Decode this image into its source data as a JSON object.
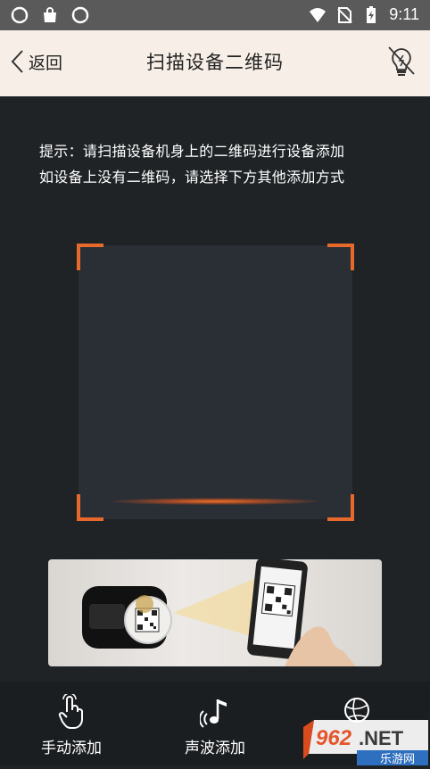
{
  "status_bar": {
    "time": "9:11",
    "icons_left": [
      "sync-icon",
      "shopping-bag-icon",
      "sync-icon"
    ],
    "icons_right": [
      "wifi-icon",
      "no-sim-icon",
      "battery-charging-icon"
    ]
  },
  "header": {
    "back_label": "返回",
    "title": "扫描设备二维码",
    "light_icon": "flashlight-off-icon"
  },
  "hint": {
    "line1": "提示：请扫描设备机身上的二维码进行设备添加",
    "line2": "如设备上没有二维码，请选择下方其他添加方式"
  },
  "colors": {
    "accent": "#e7692c",
    "background": "#1f2326",
    "header_bg": "#f7efe7",
    "bottom_bar_bg": "#1b1e21"
  },
  "bottom_tabs": [
    {
      "label": "手动添加",
      "icon": "hand-tap-icon"
    },
    {
      "label": "声波添加",
      "icon": "sound-wave-icon"
    },
    {
      "label": "",
      "icon": "globe-icon"
    }
  ],
  "watermark": {
    "text": "962.NET",
    "subtext": "乐游网"
  }
}
